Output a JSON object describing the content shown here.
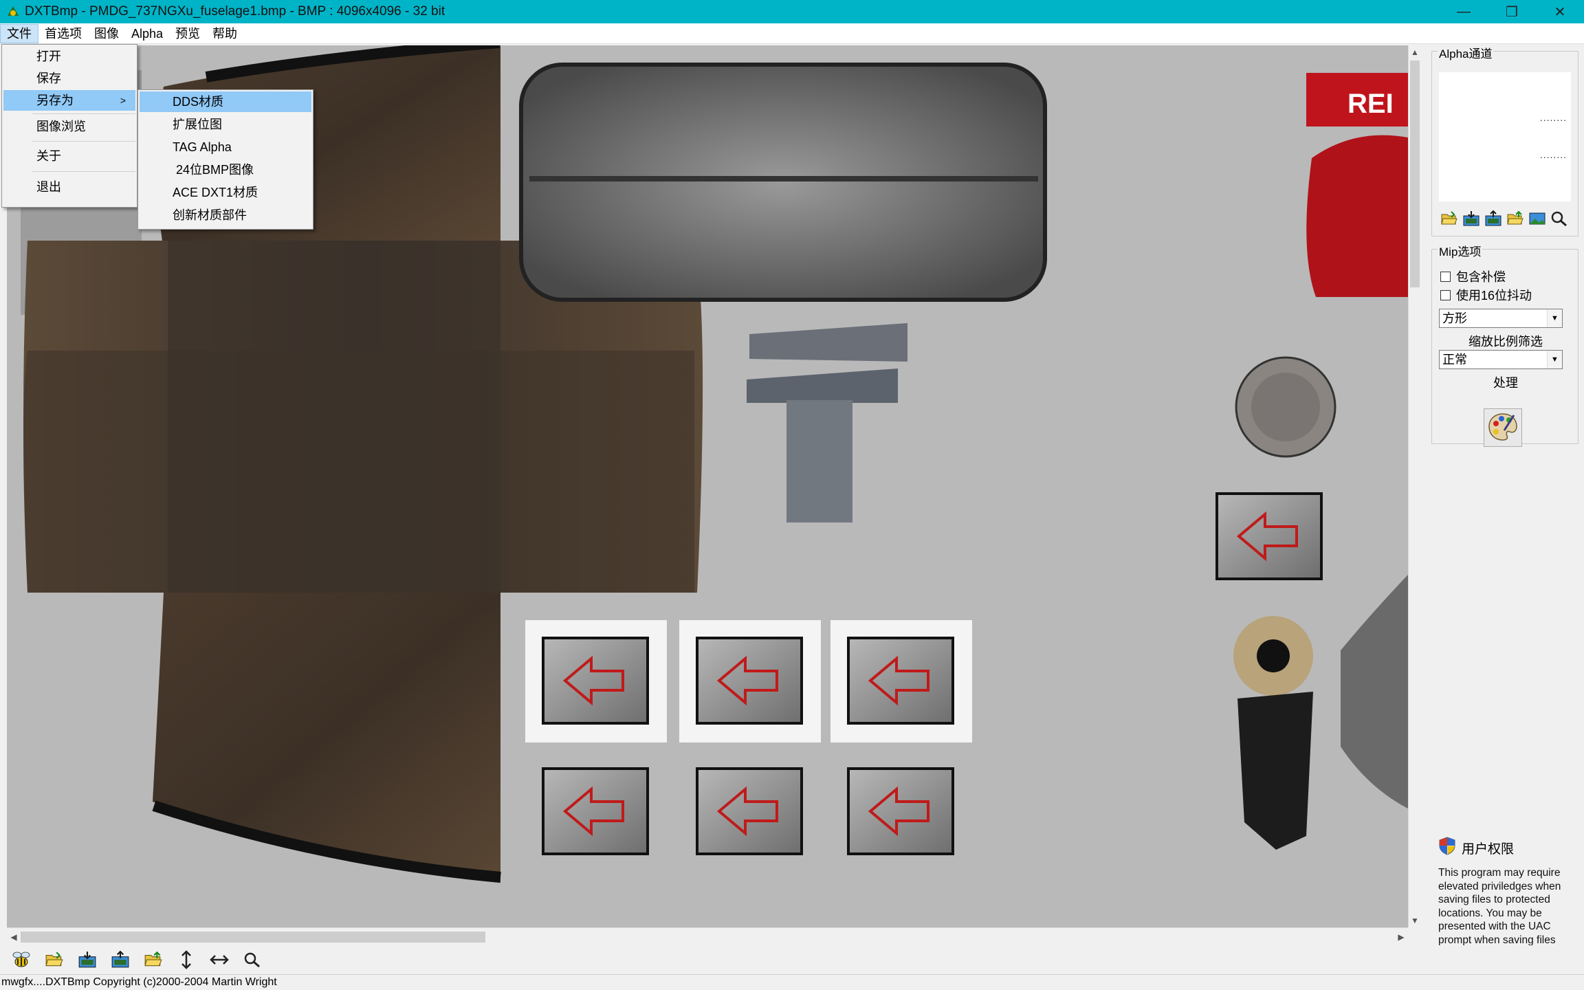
{
  "window": {
    "title": "DXTBmp - PMDG_737NGXu_fuselage1.bmp - BMP : 4096x4096 - 32 bit",
    "minimize": "—",
    "maximize": "❐",
    "close": "✕"
  },
  "menubar": {
    "items": [
      "文件",
      "首选项",
      "图像",
      "Alpha",
      "预览",
      "帮助"
    ]
  },
  "file_menu": {
    "items": [
      {
        "label": "打开"
      },
      {
        "label": "保存"
      },
      {
        "label": "另存为",
        "has_submenu": true,
        "highlighted": true
      },
      {
        "label": "图像浏览"
      },
      {
        "label": "关于"
      },
      {
        "label": "退出"
      }
    ],
    "submenu_arrow": ">"
  },
  "save_as_submenu": {
    "items": [
      {
        "label": "DDS材质",
        "highlighted": true
      },
      {
        "label": "扩展位图"
      },
      {
        "label": "TAG Alpha"
      },
      {
        "label": " 24位BMP图像"
      },
      {
        "label": "ACE DXT1材质"
      },
      {
        "label": "创新材质部件"
      }
    ]
  },
  "right_panel": {
    "alpha_group_label": "Alpha通道",
    "alpha_dots": [
      "........",
      "........"
    ],
    "alpha_icons": [
      "open-folder-icon",
      "save-down-icon",
      "export-image-icon",
      "open-folder-alt-icon",
      "image-preview-icon",
      "zoom-icon"
    ],
    "mip_group_label": "Mip选项",
    "checkbox_compensate": "包含补偿",
    "checkbox_dither": "使用16位抖动",
    "shape_select": "方形",
    "scale_filter_label": "缩放比例筛选",
    "filter_select": "正常",
    "process_label": "处理",
    "uac_title": "用户权限",
    "uac_text": "This program may require elevated priviledges when saving files to protected locations. You may be presented with the UAC prompt when saving files"
  },
  "toolbar": {
    "icons": [
      "bee-icon",
      "open-folder-icon",
      "save-down-icon",
      "export-image-icon",
      "open-folder-alt-icon",
      "flip-vertical-icon",
      "flip-horizontal-icon",
      "zoom-icon"
    ]
  },
  "status": {
    "text": "mwgfx....DXTBmp Copyright (c)2000-2004 Martin Wright"
  },
  "texture_sign_text": "REI",
  "colors": {
    "titlebar": "#00b4c8",
    "menu_highlight": "#91c9f7",
    "canvas_bg": "#b9b9b9",
    "brand_red": "#c0141c"
  }
}
